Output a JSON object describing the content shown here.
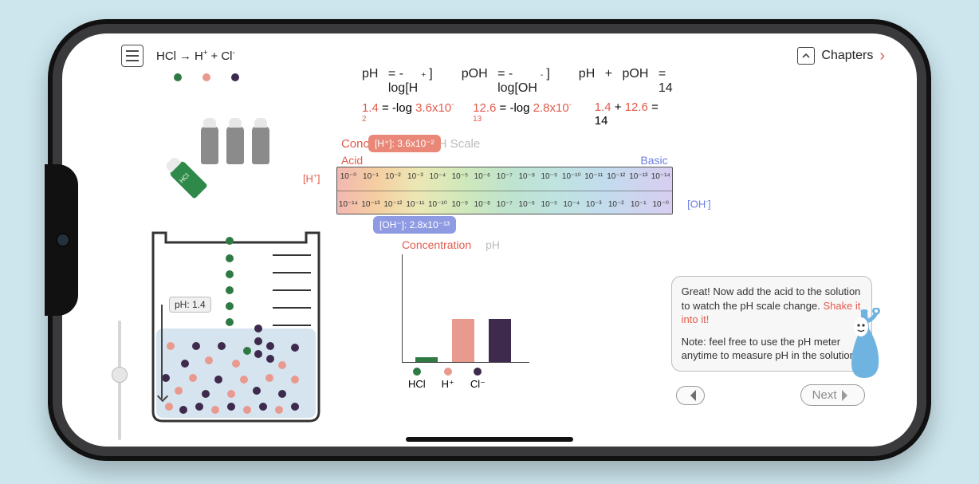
{
  "header": {
    "reaction_left": "HCl",
    "reaction_arrow": "→",
    "reaction_right_1": "H",
    "reaction_right_1_sup": "+",
    "reaction_plus": "+",
    "reaction_right_2": "Cl",
    "reaction_right_2_sup": "-",
    "chapters_label": "Chapters"
  },
  "formulas": {
    "ph_lhs": "pH",
    "ph_eq": "= -log[H",
    "ph_sup": "+",
    "ph_close": "]",
    "poh_lhs": "pOH",
    "poh_eq": "= -log[OH",
    "poh_sup": "-",
    "poh_close": "]",
    "sum_lhs_a": "pH",
    "sum_plus": "+",
    "sum_lhs_b": "pOH",
    "sum_eq": "= 14"
  },
  "values": {
    "ph_val": "1.4",
    "neglog1": "= -log",
    "h_conc": "3.6x10",
    "h_exp": "-2",
    "poh_val": "12.6",
    "neglog2": "= -log",
    "oh_conc": "2.8x10",
    "oh_exp": "-13",
    "sum_a": "1.4",
    "sum_plus": "+",
    "sum_b": "12.6",
    "sum_eq": "= 14"
  },
  "tabs": {
    "concentration": "Concentration",
    "phscale": "pH Scale"
  },
  "scale": {
    "acid": "Acid",
    "basic": "Basic",
    "h_label": "[H",
    "h_sup": "+",
    "h_close": "]",
    "oh_label": "[OH",
    "oh_sup": "-",
    "oh_close": "]",
    "tops": [
      "10⁻⁰",
      "10⁻¹",
      "10⁻²",
      "10⁻³",
      "10⁻⁴",
      "10⁻⁵",
      "10⁻⁶",
      "10⁻⁷",
      "10⁻⁸",
      "10⁻⁹",
      "10⁻¹⁰",
      "10⁻¹¹",
      "10⁻¹²",
      "10⁻¹³",
      "10⁻¹⁴"
    ],
    "bots": [
      "10⁻¹⁴",
      "10⁻¹³",
      "10⁻¹²",
      "10⁻¹¹",
      "10⁻¹⁰",
      "10⁻⁹",
      "10⁻⁸",
      "10⁻⁷",
      "10⁻⁶",
      "10⁻⁵",
      "10⁻⁴",
      "10⁻³",
      "10⁻²",
      "10⁻¹",
      "10⁻⁰"
    ],
    "bubble_h": "[H⁺]: 3.6x10⁻²",
    "bubble_oh": "[OH⁻]: 2.8x10⁻¹³"
  },
  "bar_tabs": {
    "concentration": "Concentration",
    "ph": "pH"
  },
  "bars_legend": {
    "a": "HCl",
    "b": "H⁺",
    "c": "Cl⁻"
  },
  "chart_data": {
    "type": "bar",
    "categories": [
      "HCl",
      "H+",
      "Cl-"
    ],
    "values": [
      0.04,
      0.4,
      0.4
    ],
    "title": "Concentration",
    "xlabel": "",
    "ylabel": "",
    "ylim": [
      0,
      1
    ]
  },
  "phmeter": {
    "label": "pH: 1.4"
  },
  "shaker": {
    "held_label": "HCl"
  },
  "speech": {
    "line1a": "Great! Now add the acid to the solution to watch the pH scale change. ",
    "line1b": "Shake it into it!",
    "line2": "Note: feel free to use the pH meter anytime to measure pH in the solution."
  },
  "nav": {
    "next": "Next"
  }
}
